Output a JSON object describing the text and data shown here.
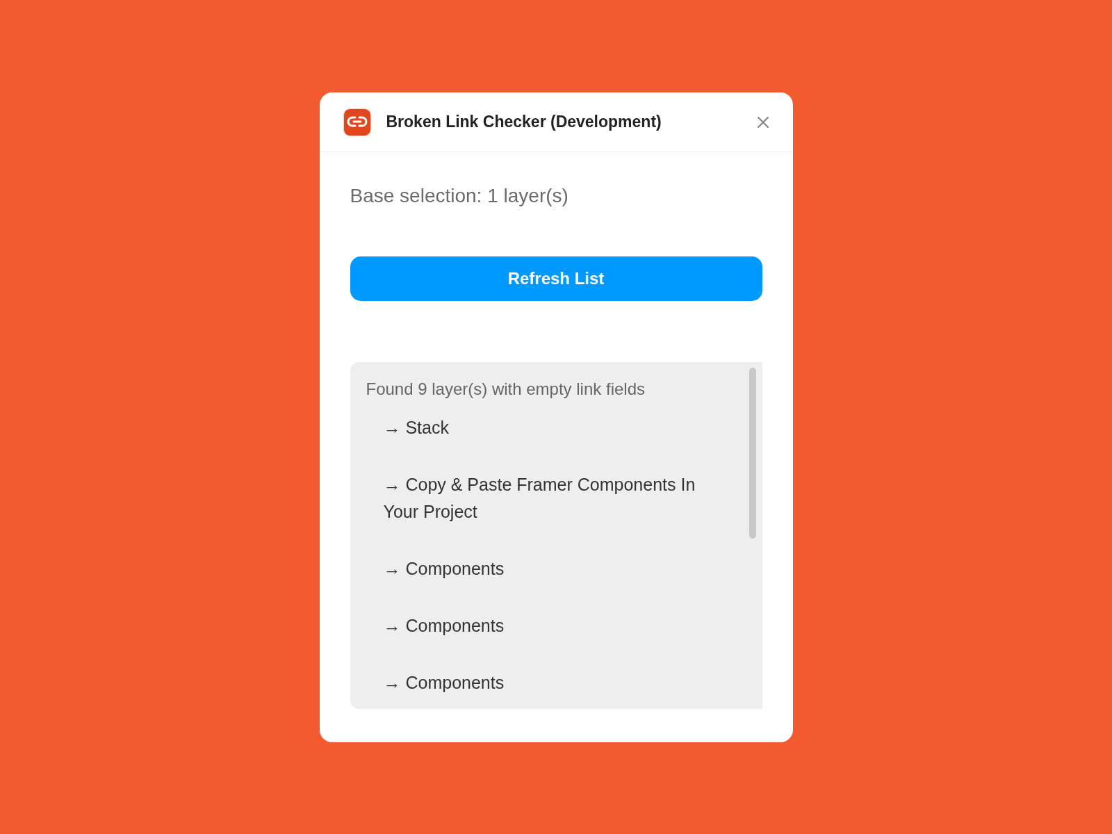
{
  "window": {
    "title": "Broken Link Checker (Development)"
  },
  "base_selection": "Base selection: 1 layer(s)",
  "refresh_button": "Refresh List",
  "results": {
    "summary": "Found 9 layer(s) with empty link fields",
    "items": [
      "→ Stack",
      "→ Copy & Paste Framer Components In Your Project",
      "→ Components",
      "→ Components",
      "→ Components"
    ]
  }
}
